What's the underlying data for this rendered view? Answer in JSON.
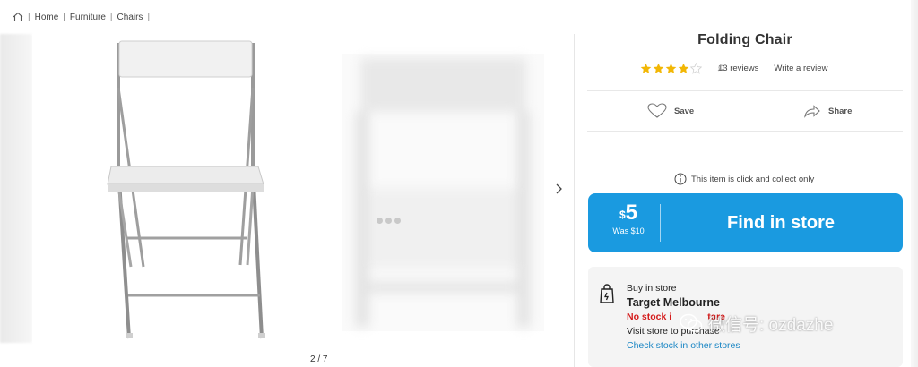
{
  "breadcrumb": {
    "items": [
      "Home",
      "Furniture",
      "Chairs"
    ]
  },
  "gallery": {
    "counter": "2 / 7"
  },
  "product": {
    "title": "Folding Chair",
    "rating": 4,
    "rating_max": 5,
    "reviews_label": "13 reviews",
    "write_review_label": "Write a review"
  },
  "actions": {
    "save_label": "Save",
    "share_label": "Share"
  },
  "notice": "This item is click and collect only",
  "purchase": {
    "price_symbol": "$",
    "price_value": "5",
    "was_price": "Was $10",
    "find_label": "Find in store"
  },
  "store": {
    "heading": "Buy in store",
    "name": "Target Melbourne",
    "stock_status": "No stock i",
    "stock_status_tail": "tore",
    "visit_text": "Visit store to pu",
    "visit_text_tail": "rchase",
    "check_link": "Check stock in other stores"
  },
  "watermark": {
    "text": "微信号: ozdazhe"
  },
  "colors": {
    "accent": "#1a9ae0",
    "star": "#f2b705",
    "out_of_stock": "#d41c1c",
    "link": "#1a86c4"
  }
}
